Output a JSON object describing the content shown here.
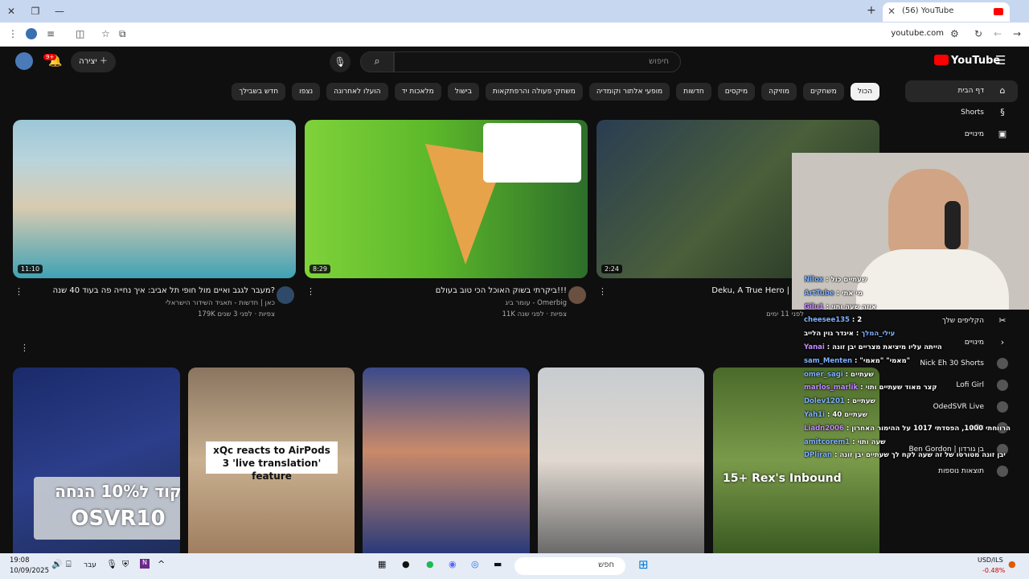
{
  "browser": {
    "tab_title": "(56) YouTube",
    "url": "youtube.com"
  },
  "youtube": {
    "search_placeholder": "חיפוש",
    "create_label": "יצירה",
    "notification_badge": "9+",
    "logo_text": "YouTube",
    "chips": [
      {
        "label": "הכול",
        "active": true
      },
      {
        "label": "משחקים"
      },
      {
        "label": "מוזיקה"
      },
      {
        "label": "מיקסים"
      },
      {
        "label": "חדשות"
      },
      {
        "label": "מופעי אלתור וקומדיה"
      },
      {
        "label": "משחקי פעולה והרפתקאות"
      },
      {
        "label": "בישול"
      },
      {
        "label": "מלאכות יד"
      },
      {
        "label": "הועלו לאחרונה"
      },
      {
        "label": "נצפו"
      },
      {
        "label": "חדש בשבילך"
      }
    ],
    "sidebar": [
      {
        "label": "דף הבית",
        "icon": "home-icon",
        "active": true
      },
      {
        "label": "Shorts",
        "icon": "shorts-icon"
      },
      {
        "label": "מינויים",
        "icon": "subscriptions-icon"
      }
    ],
    "sidebar_lower": [
      {
        "label": "הקליפים שלך",
        "icon": "scissors-icon"
      },
      {
        "label": "מינויים",
        "icon": "chevron-icon"
      },
      {
        "label": "Nick Eh 30 Shorts"
      },
      {
        "label": "Lofi Girl"
      },
      {
        "label": "OdedSVR Live"
      },
      {
        "label": "xQc"
      },
      {
        "label": "Ben Gordon | בן גורדון"
      },
      {
        "label": "תוצאות נוספות"
      }
    ],
    "videos": [
      {
        "title": "מעבר לגגב ואיים מול חופי תל אביב: איך נחייה פה בעוד 40 שנה?",
        "channel": "כאן | חדשות - תאגיד השידור הישראלי",
        "meta": "179K צפיות · לפני 3 שנים",
        "duration": "11:10"
      },
      {
        "title": "ביקרתי בשוק האוכל הכי טוב בעולם!!!",
        "channel": "עומר ביג - Omerbig",
        "meta": "11K צפיות · לפני שנה",
        "duration": "8:29"
      },
      {
        "title": "Deku, A True Hero |",
        "channel": "",
        "meta": "לפני 11 ימים",
        "duration": "2:24"
      }
    ],
    "shorts_overlay": {
      "promo_line1": "קוד ל10% הנחה",
      "promo_line2": "OSVR10",
      "xqc_caption": "xQc reacts to AirPods 3 'live translation' feature",
      "rex_caption": "15+ Rex's Inbound"
    }
  },
  "chat": [
    {
      "user": "Nilox",
      "msg": "שעתיים כול"
    },
    {
      "user": "ArtTube",
      "msg": "מי אתי"
    },
    {
      "user": "Gilu1",
      "msg": "איזה שעה ותוי"
    },
    {
      "user": "cheesee135",
      "msg": "2"
    },
    {
      "user": "עילי_המלך",
      "msg": "אינדר גוין הלייב"
    },
    {
      "user": "Yanai",
      "msg": "הייתה עליו מיציאת מצריים יבן זונה"
    },
    {
      "user": "sam_Menten",
      "msg": "\"מאמי\" \"מאמי\""
    },
    {
      "user": "omer_sagi",
      "msg": "שעתיים"
    },
    {
      "user": "marlos_marlik",
      "msg": "קצר מאוד שעתיים ותוי"
    },
    {
      "user": "Dolev1201",
      "msg": "שעתיים"
    },
    {
      "user": "Yah1i",
      "msg": "שעתיים 40"
    },
    {
      "user": "Liadn2006",
      "msg": "הרווחתי 1000, הפסדתי 1017 על ההימור האחרון"
    },
    {
      "user": "amitcorem1",
      "msg": "שעה ותוי"
    },
    {
      "user": "DPliran",
      "msg": "יבן זונה מטורסו של זה שעה לקח לך שעתיים יבן זונה"
    }
  ],
  "taskbar": {
    "time": "19:08",
    "date": "10/09/2025",
    "lang": "עבר",
    "search": "חפש",
    "stock_name": "USD/ILS",
    "stock_change": "-0.48%"
  }
}
